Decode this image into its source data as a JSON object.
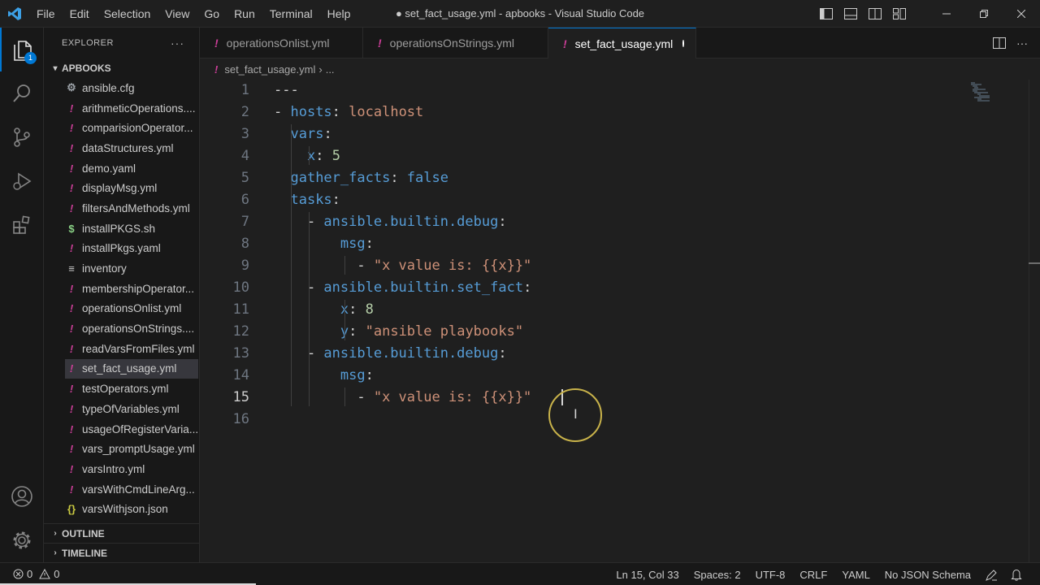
{
  "titlebar": {
    "menu": [
      "File",
      "Edit",
      "Selection",
      "View",
      "Go",
      "Run",
      "Terminal",
      "Help"
    ],
    "title": "● set_fact_usage.yml - apbooks - Visual Studio Code"
  },
  "activitybar": {
    "explorer_badge": "1"
  },
  "sidebar": {
    "header": "EXPLORER",
    "more": "···",
    "folder": "APBOOKS",
    "files": [
      {
        "icon": "⚙",
        "type": "gear",
        "name": "ansible.cfg"
      },
      {
        "icon": "!",
        "type": "yml",
        "name": "arithmeticOperations...."
      },
      {
        "icon": "!",
        "type": "yml",
        "name": "comparisionOperator..."
      },
      {
        "icon": "!",
        "type": "yml",
        "name": "dataStructures.yml"
      },
      {
        "icon": "!",
        "type": "yml",
        "name": "demo.yaml"
      },
      {
        "icon": "!",
        "type": "yml",
        "name": "displayMsg.yml"
      },
      {
        "icon": "!",
        "type": "yml",
        "name": "filtersAndMethods.yml"
      },
      {
        "icon": "$",
        "type": "sh",
        "name": "installPKGS.sh"
      },
      {
        "icon": "!",
        "type": "yml",
        "name": "installPkgs.yaml"
      },
      {
        "icon": "≡",
        "type": "inv",
        "name": "inventory"
      },
      {
        "icon": "!",
        "type": "yml",
        "name": "membershipOperator..."
      },
      {
        "icon": "!",
        "type": "yml",
        "name": "operationsOnlist.yml"
      },
      {
        "icon": "!",
        "type": "yml",
        "name": "operationsOnStrings...."
      },
      {
        "icon": "!",
        "type": "yml",
        "name": "readVarsFromFiles.yml"
      },
      {
        "icon": "!",
        "type": "yml",
        "name": "set_fact_usage.yml",
        "selected": true
      },
      {
        "icon": "!",
        "type": "yml",
        "name": "testOperators.yml"
      },
      {
        "icon": "!",
        "type": "yml",
        "name": "typeOfVariables.yml"
      },
      {
        "icon": "!",
        "type": "yml",
        "name": "usageOfRegisterVaria..."
      },
      {
        "icon": "!",
        "type": "yml",
        "name": "vars_promptUsage.yml"
      },
      {
        "icon": "!",
        "type": "yml",
        "name": "varsIntro.yml"
      },
      {
        "icon": "!",
        "type": "yml",
        "name": "varsWithCmdLineArg..."
      },
      {
        "icon": "{}",
        "type": "json",
        "name": "varsWithjson.json"
      }
    ],
    "outline": "OUTLINE",
    "timeline": "TIMELINE"
  },
  "tabs": [
    {
      "name": "operationsOnlist.yml",
      "active": false
    },
    {
      "name": "operationsOnStrings.yml",
      "active": false
    },
    {
      "name": "set_fact_usage.yml",
      "active": true,
      "dirty": true
    }
  ],
  "breadcrumb": {
    "file": "set_fact_usage.yml",
    "sep": "›",
    "more": "..."
  },
  "editor": {
    "current_line": 15,
    "lines": [
      [
        [
          "p",
          "---"
        ]
      ],
      [
        [
          "p",
          "- "
        ],
        [
          "k",
          "hosts"
        ],
        [
          "p",
          ": "
        ],
        [
          "s",
          "localhost"
        ]
      ],
      [
        [
          "p",
          "  "
        ],
        [
          "k",
          "vars"
        ],
        [
          "p",
          ":"
        ]
      ],
      [
        [
          "p",
          "    "
        ],
        [
          "k",
          "x"
        ],
        [
          "p",
          ": "
        ],
        [
          "n",
          "5"
        ]
      ],
      [
        [
          "p",
          "  "
        ],
        [
          "k",
          "gather_facts"
        ],
        [
          "p",
          ": "
        ],
        [
          "b",
          "false"
        ]
      ],
      [
        [
          "p",
          "  "
        ],
        [
          "k",
          "tasks"
        ],
        [
          "p",
          ":"
        ]
      ],
      [
        [
          "p",
          "    - "
        ],
        [
          "k",
          "ansible.builtin.debug"
        ],
        [
          "p",
          ":"
        ]
      ],
      [
        [
          "p",
          "        "
        ],
        [
          "k",
          "msg"
        ],
        [
          "p",
          ":"
        ]
      ],
      [
        [
          "p",
          "          - "
        ],
        [
          "s",
          "\"x value is: {{x}}\""
        ]
      ],
      [
        [
          "p",
          "    - "
        ],
        [
          "k",
          "ansible.builtin.set_fact"
        ],
        [
          "p",
          ":"
        ]
      ],
      [
        [
          "p",
          "        "
        ],
        [
          "k",
          "x"
        ],
        [
          "p",
          ": "
        ],
        [
          "n",
          "8"
        ]
      ],
      [
        [
          "p",
          "        "
        ],
        [
          "k",
          "y"
        ],
        [
          "p",
          ": "
        ],
        [
          "s",
          "\"ansible playbooks\""
        ]
      ],
      [
        [
          "p",
          "    - "
        ],
        [
          "k",
          "ansible.builtin.debug"
        ],
        [
          "p",
          ":"
        ]
      ],
      [
        [
          "p",
          "        "
        ],
        [
          "k",
          "msg"
        ],
        [
          "p",
          ":"
        ]
      ],
      [
        [
          "p",
          "          - "
        ],
        [
          "s",
          "\"x value is: {{x}}\""
        ],
        [
          "p",
          " "
        ]
      ],
      []
    ]
  },
  "statusbar": {
    "errors": "0",
    "warnings": "0",
    "position": "Ln 15, Col 33",
    "spaces": "Spaces: 2",
    "encoding": "UTF-8",
    "eol": "CRLF",
    "language": "YAML",
    "schema": "No JSON Schema"
  },
  "colors": {
    "accent": "#0078d4",
    "key": "#569cd6",
    "string": "#ce9178",
    "number": "#b5cea8",
    "yml_icon": "#cc3e98"
  }
}
